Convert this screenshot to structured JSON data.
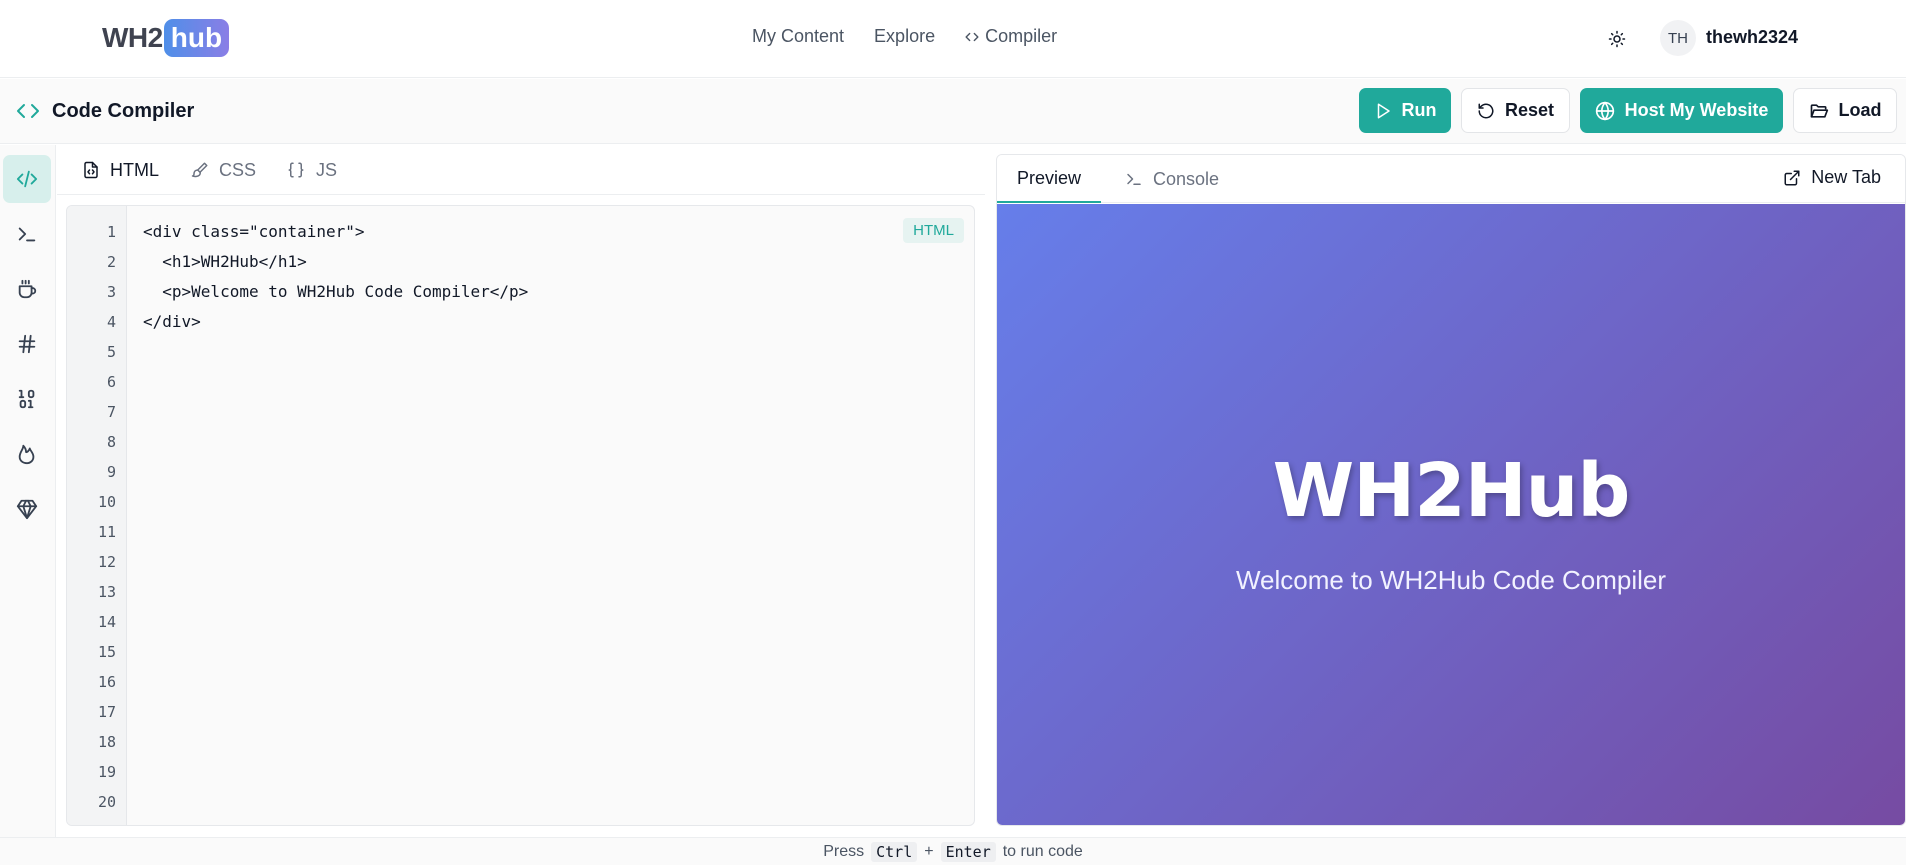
{
  "app": {
    "logo_left": "WH2",
    "logo_right": "hub"
  },
  "nav": {
    "links": [
      "My Content",
      "Explore",
      "Compiler"
    ],
    "user_initials": "TH",
    "username": "thewh2324"
  },
  "toolbar": {
    "title": "Code Compiler",
    "run_label": "Run",
    "reset_label": "Reset",
    "host_label": "Host My Website",
    "load_label": "Load"
  },
  "sidebar": {
    "items": [
      "html-code-icon",
      "terminal-icon",
      "coffee-icon",
      "hash-icon",
      "binary-icon",
      "flame-icon",
      "gem-icon"
    ],
    "active_index": 0
  },
  "editor": {
    "tabs": [
      {
        "label": "HTML",
        "icon": "file-code-icon",
        "active": true
      },
      {
        "label": "CSS",
        "icon": "paintbrush-icon",
        "active": false
      },
      {
        "label": "JS",
        "icon": "braces-icon",
        "active": false
      }
    ],
    "language_badge": "HTML",
    "line_numbers": [
      "1",
      "2",
      "3",
      "4",
      "5",
      "6",
      "7",
      "8",
      "9",
      "10",
      "11",
      "12",
      "13",
      "14",
      "15",
      "16",
      "17",
      "18",
      "19",
      "20"
    ],
    "code_lines": [
      "<div class=\"container\">",
      "  <h1>WH2Hub</h1>",
      "  <p>Welcome to WH2Hub Code Compiler</p>",
      "</div>"
    ]
  },
  "preview": {
    "tabs": [
      {
        "label": "Preview",
        "active": true
      },
      {
        "label": "Console",
        "active": false
      }
    ],
    "new_tab_label": "New Tab",
    "heading": "WH2Hub",
    "paragraph": "Welcome to WH2Hub Code Compiler",
    "gradient_start": "#667eea",
    "gradient_end": "#764ba2"
  },
  "footer": {
    "press": "Press",
    "key1": "Ctrl",
    "plus": "+",
    "key2": "Enter",
    "suffix": "to run code"
  },
  "colors": {
    "accent": "#20a99b",
    "active_bg": "#d7efec"
  }
}
